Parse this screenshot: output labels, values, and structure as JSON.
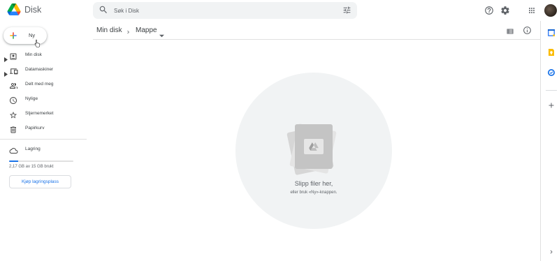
{
  "app": {
    "name": "Disk"
  },
  "search": {
    "placeholder": "Søk i Disk",
    "icon": "search-icon",
    "filter_icon": "tune-icon"
  },
  "header": {
    "help_icon": "help-icon",
    "settings_icon": "gear-icon",
    "apps_icon": "apps-grid-icon",
    "account_icon": "avatar"
  },
  "new_button": {
    "label": "Ny",
    "icon": "plus-icon"
  },
  "sidebar": {
    "items": [
      {
        "label": "Min disk",
        "icon": "drive-icon",
        "expandable": true
      },
      {
        "label": "Datamaskiner",
        "icon": "computer-icon",
        "expandable": true
      },
      {
        "label": "Delt med meg",
        "icon": "people-icon",
        "expandable": false
      },
      {
        "label": "Nylige",
        "icon": "clock-icon",
        "expandable": false
      },
      {
        "label": "Stjernemerket",
        "icon": "star-icon",
        "expandable": false
      },
      {
        "label": "Papirkurv",
        "icon": "trash-icon",
        "expandable": false
      }
    ],
    "storage": {
      "label": "Lagring",
      "icon": "cloud-icon",
      "usage_text": "2,17 GB av 15 GB brukt",
      "used_fraction": 0.145,
      "buy_label": "Kjøp lagringsplass"
    }
  },
  "breadcrumb": {
    "root": "Min disk",
    "current": "Mappe"
  },
  "view": {
    "list_icon": "list-view-icon",
    "info_icon": "info-icon"
  },
  "empty_state": {
    "title": "Slipp filer her,",
    "subtitle": "eller bruk «Ny»-knappen."
  },
  "right_panel": {
    "apps": [
      "calendar-icon",
      "keep-icon",
      "tasks-icon"
    ],
    "add_icon": "plus-icon",
    "expand_icon": "chevron-right-icon"
  },
  "colors": {
    "accent": "#1a73e8",
    "google_red": "#ea4335",
    "google_yellow": "#fbbc04",
    "google_green": "#34a853"
  }
}
